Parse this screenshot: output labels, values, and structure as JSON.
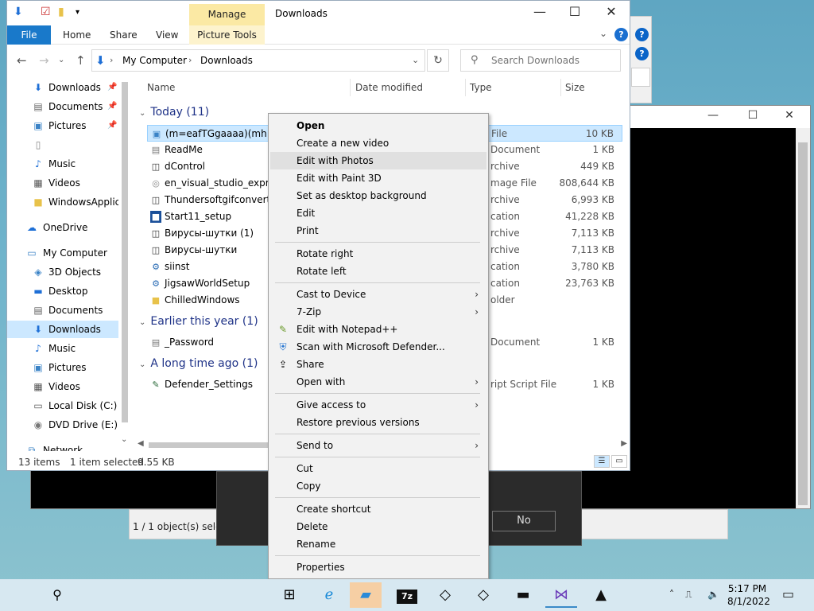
{
  "window": {
    "title": "Downloads",
    "manage_tab": "Manage",
    "ribbon_tabs": [
      "File",
      "Home",
      "Share",
      "View",
      "Picture Tools"
    ]
  },
  "address": {
    "crumbs": [
      "My Computer",
      "Downloads"
    ],
    "search_placeholder": "Search Downloads"
  },
  "nav": {
    "items": [
      {
        "label": "Downloads",
        "icon": "download-icon",
        "pinned": true
      },
      {
        "label": "Documents",
        "icon": "document-icon",
        "pinned": true
      },
      {
        "label": "Pictures",
        "icon": "pictures-icon",
        "pinned": true
      },
      {
        "label": "",
        "icon": "blank-file-icon",
        "pinned": false
      },
      {
        "label": "Music",
        "icon": "music-icon",
        "pinned": false
      },
      {
        "label": "Videos",
        "icon": "videos-icon",
        "pinned": false
      },
      {
        "label": "WindowsApplica",
        "icon": "folder-icon",
        "pinned": false
      },
      {
        "label": "OneDrive",
        "icon": "cloud-icon",
        "pinned": false
      },
      {
        "label": "My Computer",
        "icon": "computer-icon",
        "pinned": false
      },
      {
        "label": "3D Objects",
        "icon": "cube-icon",
        "pinned": false
      },
      {
        "label": "Desktop",
        "icon": "desktop-icon",
        "pinned": false
      },
      {
        "label": "Documents",
        "icon": "document-icon",
        "pinned": false
      },
      {
        "label": "Downloads",
        "icon": "download-icon",
        "pinned": false
      },
      {
        "label": "Music",
        "icon": "music-icon",
        "pinned": false
      },
      {
        "label": "Pictures",
        "icon": "pictures-icon",
        "pinned": false
      },
      {
        "label": "Videos",
        "icon": "videos-icon",
        "pinned": false
      },
      {
        "label": "Local Disk (C:)",
        "icon": "disk-icon",
        "pinned": false
      },
      {
        "label": "DVD Drive (E:) VS",
        "icon": "dvd-icon",
        "pinned": false
      },
      {
        "label": "Network",
        "icon": "network-icon",
        "pinned": false
      }
    ]
  },
  "columns": {
    "name": "Name",
    "date": "Date modified",
    "type": "Type",
    "size": "Size"
  },
  "groups": {
    "today": "Today (11)",
    "earlier": "Earlier this year (1)",
    "longago": "A long time ago (1)"
  },
  "files": [
    {
      "name": "(m=eafTGgaaaa)(mh=iP3",
      "type": "File",
      "size": "10 KB",
      "icon": "image-file-icon"
    },
    {
      "name": "ReadMe",
      "type": "Document",
      "size": "1 KB",
      "icon": "text-file-icon"
    },
    {
      "name": "dControl",
      "type": "rchive",
      "size": "449 KB",
      "icon": "archive-icon"
    },
    {
      "name": "en_visual_studio_express_",
      "type": "mage File",
      "size": "808,644 KB",
      "icon": "disc-image-icon"
    },
    {
      "name": "Thundersoftgifconverter4",
      "type": "rchive",
      "size": "6,993 KB",
      "icon": "archive-icon"
    },
    {
      "name": "Start11_setup",
      "type": "cation",
      "size": "41,228 KB",
      "icon": "app-icon"
    },
    {
      "name": "Вирусы-шутки (1)",
      "type": "rchive",
      "size": "7,113 KB",
      "icon": "archive-icon"
    },
    {
      "name": "Вирусы-шутки",
      "type": "rchive",
      "size": "7,113 KB",
      "icon": "archive-icon"
    },
    {
      "name": "siinst",
      "type": "cation",
      "size": "3,780 KB",
      "icon": "installer-icon"
    },
    {
      "name": "JigsawWorldSetup",
      "type": "cation",
      "size": "23,763 KB",
      "icon": "installer-icon"
    },
    {
      "name": "ChilledWindows",
      "type": "older",
      "size": "",
      "icon": "folder-icon"
    },
    {
      "name": "_Password",
      "type": "Document",
      "size": "1 KB",
      "icon": "text-file-icon"
    },
    {
      "name": "Defender_Settings",
      "type": "ript Script File",
      "size": "1 KB",
      "icon": "script-icon"
    }
  ],
  "status": {
    "count": "13 items",
    "selected": "1 item selected",
    "size": "9.55 KB"
  },
  "context_menu": {
    "items": [
      {
        "label": "Open",
        "bold": true
      },
      {
        "label": "Create a new video"
      },
      {
        "label": "Edit with Photos",
        "highlight": true
      },
      {
        "label": "Edit with Paint 3D"
      },
      {
        "label": "Set as desktop background"
      },
      {
        "label": "Edit"
      },
      {
        "label": "Print"
      },
      {
        "sep": true
      },
      {
        "label": "Rotate right"
      },
      {
        "label": "Rotate left"
      },
      {
        "sep": true
      },
      {
        "label": "Cast to Device",
        "submenu": true
      },
      {
        "label": "7-Zip",
        "submenu": true
      },
      {
        "label": "Edit with Notepad++",
        "icon": "notepad-icon"
      },
      {
        "label": "Scan with Microsoft Defender...",
        "icon": "defender-icon"
      },
      {
        "label": "Share",
        "icon": "share-icon"
      },
      {
        "label": "Open with",
        "submenu": true
      },
      {
        "sep": true
      },
      {
        "label": "Give access to",
        "submenu": true
      },
      {
        "label": "Restore previous versions"
      },
      {
        "sep": true
      },
      {
        "label": "Send to",
        "submenu": true
      },
      {
        "sep": true
      },
      {
        "label": "Cut"
      },
      {
        "label": "Copy"
      },
      {
        "sep": true
      },
      {
        "label": "Create shortcut"
      },
      {
        "label": "Delete"
      },
      {
        "label": "Rename"
      },
      {
        "sep": true
      },
      {
        "label": "Properties"
      }
    ]
  },
  "background": {
    "dialog_status": "1 / 1 object(s) select",
    "no_button": "No"
  },
  "taskbar": {
    "time": "5:17 PM",
    "date": "8/1/2022",
    "sevenzip_label": "7z"
  },
  "colors": {
    "accent": "#1979ca",
    "selection": "#cce8ff",
    "manage": "#fbe9a4"
  }
}
